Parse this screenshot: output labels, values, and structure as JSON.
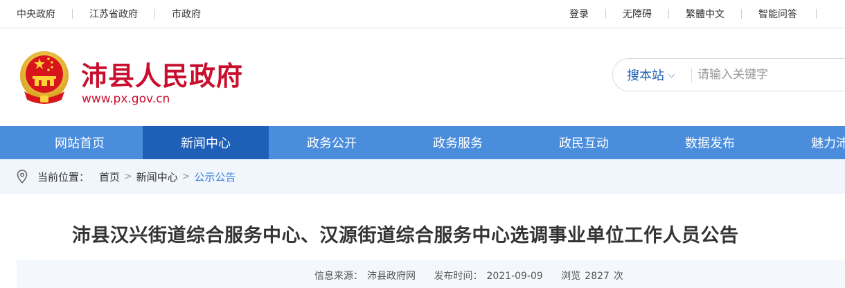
{
  "topbar": {
    "left_links": [
      "中央政府",
      "江苏省政府",
      "市政府"
    ],
    "right_links": [
      "登录",
      "无障碍",
      "繁體中文",
      "智能问答"
    ]
  },
  "header": {
    "title": "沛县人民政府",
    "url": "www.px.gov.cn",
    "search": {
      "scope": "搜本站",
      "placeholder": "请输入关键字"
    }
  },
  "nav": {
    "items": [
      "网站首页",
      "新闻中心",
      "政务公开",
      "政务服务",
      "政民互动",
      "数据发布",
      "魅力沛"
    ],
    "active_index": 1
  },
  "breadcrumb": {
    "label": "当前位置：",
    "items": [
      "首页",
      "新闻中心",
      "公示公告"
    ]
  },
  "article": {
    "title": "沛县汉兴街道综合服务中心、汉源街道综合服务中心选调事业单位工作人员公告",
    "meta": {
      "source_label": "信息来源：",
      "source": "沛县政府网",
      "date_label": "发布时间：",
      "date": "2021-09-09",
      "views_label": "浏览",
      "views": "2827",
      "views_unit": "次"
    }
  },
  "colors": {
    "brand_red": "#c8102e",
    "nav_blue": "#4a8ddc",
    "nav_active": "#1e5fb8",
    "link_blue": "#3b7ed6"
  },
  "icons": {
    "emblem": "national-emblem-icon",
    "location": "location-pin-icon",
    "dropdown": "chevron-down-icon"
  }
}
